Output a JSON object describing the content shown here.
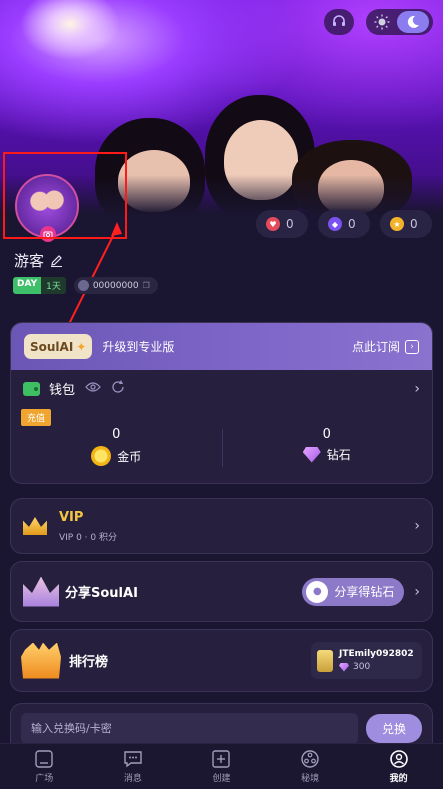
{
  "hero": {
    "theme": {
      "sun_icon": "sun-icon",
      "moon_icon": "moon-icon"
    }
  },
  "profile": {
    "username": "游客",
    "day_tag": {
      "label": "DAY",
      "value": "1天"
    },
    "id_value": "00000000"
  },
  "stats": [
    {
      "icon": "heart-icon",
      "value": "0",
      "color": "#e34a5a"
    },
    {
      "icon": "gem-icon",
      "value": "0",
      "color": "#8a62ff"
    },
    {
      "icon": "star-icon",
      "value": "0",
      "color": "#f2b32a"
    }
  ],
  "upgrade": {
    "badge": "SoulAI",
    "text": "升级到专业版",
    "action": "点此订阅"
  },
  "wallet": {
    "title": "钱包",
    "recharge": "充值",
    "coins": {
      "value": "0",
      "label": "金币"
    },
    "diamonds": {
      "value": "0",
      "label": "钻石"
    }
  },
  "vip": {
    "title": "VIP",
    "subtitle": "VIP 0 · 0 积分"
  },
  "share": {
    "title": "分享SoulAI",
    "button": "分享得钻石"
  },
  "ranking": {
    "title": "排行榜",
    "top_user": "JTEmily092802",
    "score": "300"
  },
  "redeem": {
    "placeholder": "输入兑换码/卡密",
    "button": "兑换"
  },
  "nav": [
    {
      "label": "广场",
      "icon": "square-icon"
    },
    {
      "label": "消息",
      "icon": "message-icon"
    },
    {
      "label": "创建",
      "icon": "plus-icon"
    },
    {
      "label": "秘境",
      "icon": "film-reel-icon"
    },
    {
      "label": "我的",
      "icon": "profile-icon",
      "active": true
    }
  ]
}
